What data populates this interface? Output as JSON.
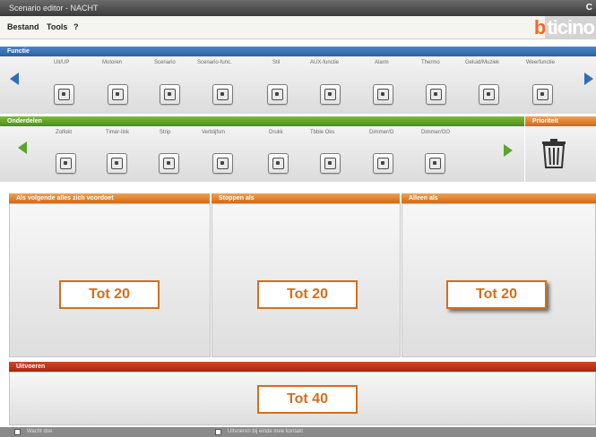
{
  "window": {
    "title": "Scenario editor - NACHT",
    "close_label": "C"
  },
  "menu": {
    "items": [
      "Bestand",
      "Tools",
      "?"
    ]
  },
  "logo": {
    "text": "bticino",
    "first": "b",
    "rest": "ticino"
  },
  "functions": {
    "header": "Functie",
    "labels": [
      "Uit/UP",
      "Motoren",
      "Scenario",
      "Scenario-func.",
      "Stil",
      "AUX-functie",
      "Alarm",
      "Thermo",
      "Geluid/Muziek",
      "Weerfunctie"
    ],
    "icons": [
      "toggle-icon",
      "motor-icon",
      "scenario-icon",
      "scenario-function-icon",
      "clock-icon",
      "power-icon",
      "alarm-icon",
      "thermometer-icon",
      "speaker-icon",
      "weather-icon"
    ]
  },
  "conditions": {
    "header": "Onderdelen",
    "labels": [
      "Zolfokt",
      "Timer-link",
      "Strip",
      "Verblijfsm",
      "Drukk",
      "Tbble Oks",
      "Dimmer/O",
      "Dimmer/OO"
    ],
    "icons": [
      "lamp-icon",
      "timer-icon",
      "return-icon",
      "user-icon",
      "battery-icon",
      "camera-icon",
      "dimmer-icon",
      "dimmer-plus-icon"
    ]
  },
  "delete": {
    "header": "Prioriteit",
    "icon": "trash-icon"
  },
  "panels": [
    {
      "header": "Als volgende alles zich voordoet",
      "callout": "Tot 20"
    },
    {
      "header": "Stoppen als",
      "callout": "Tot 20"
    },
    {
      "header": "Alleen als",
      "callout": "Tot 20"
    }
  ],
  "actions": {
    "header": "Uitvoeren",
    "callout": "Tot 40"
  },
  "footer": {
    "checkbox1": "Wacht doe",
    "checkbox2": "Uitvoeren bij einde mee kontakt"
  },
  "colors": {
    "accent_orange": "#d46f1c",
    "blue_band": "#2b5f9e",
    "green_band": "#4e8d1a",
    "red_band": "#a8260e"
  }
}
